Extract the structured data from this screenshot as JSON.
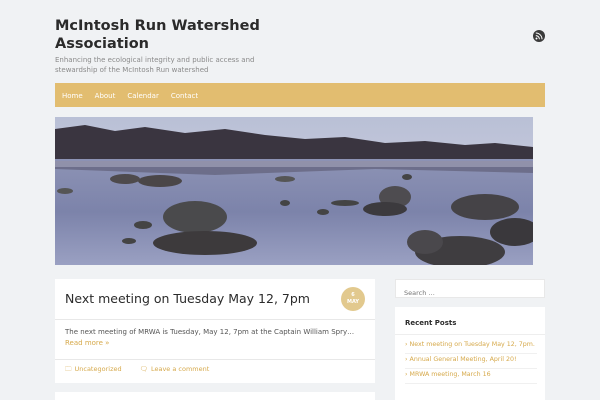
{
  "header": {
    "site_title": "McIntosh Run Watershed Association",
    "tagline": "Enhancing the ecological integrity and public access and stewardship of the McIntosh Run watershed",
    "rss_icon": "rss-icon"
  },
  "nav": {
    "items": [
      {
        "label": "Home"
      },
      {
        "label": "About"
      },
      {
        "label": "Calendar"
      },
      {
        "label": "Contact"
      }
    ]
  },
  "colors": {
    "accent": "#e2bd70",
    "link": "#d6a94b",
    "background": "#f0f2f4"
  },
  "post": {
    "title": "Next meeting on Tuesday May 12, 7pm",
    "date_day": "6",
    "date_month": "MAY",
    "excerpt": "The next meeting of MRWA is Tuesday, May 12, 7pm at the Captain William Spry…",
    "read_more": "Read more »",
    "category": "Uncategorized",
    "comment_link": "Leave a comment"
  },
  "sidebar": {
    "search_placeholder": "Search …",
    "recent_title": "Recent Posts",
    "recent_posts": [
      {
        "label": "Next meeting on Tuesday May 12, 7pm."
      },
      {
        "label": "Annual General Meeting, April 20!"
      },
      {
        "label": "MRWA meeting, March 16"
      }
    ]
  }
}
